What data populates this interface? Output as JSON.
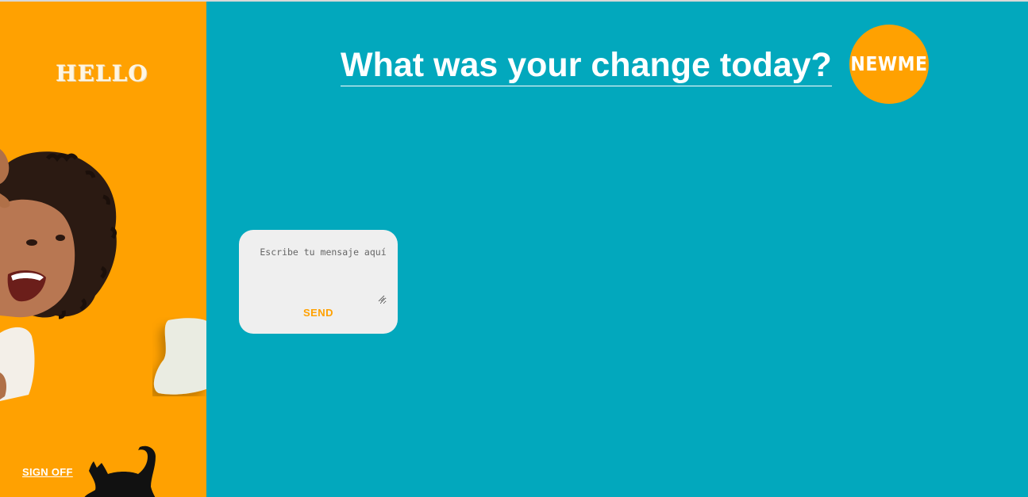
{
  "sidebar": {
    "greeting": "HELLO",
    "sign_off_label": "SIGN OFF",
    "illustration_icon": "girl-photo",
    "cat_icon": "cat-silhouette-icon"
  },
  "main": {
    "title": "What was your change today?",
    "logo_text": "NEWME"
  },
  "message_form": {
    "placeholder": "Escribe tu mensaje aquí",
    "send_label": "SEND"
  },
  "colors": {
    "accent": "#ffa101",
    "background": "#02a8bd",
    "card": "#efefef",
    "text_light": "#ffffff"
  }
}
